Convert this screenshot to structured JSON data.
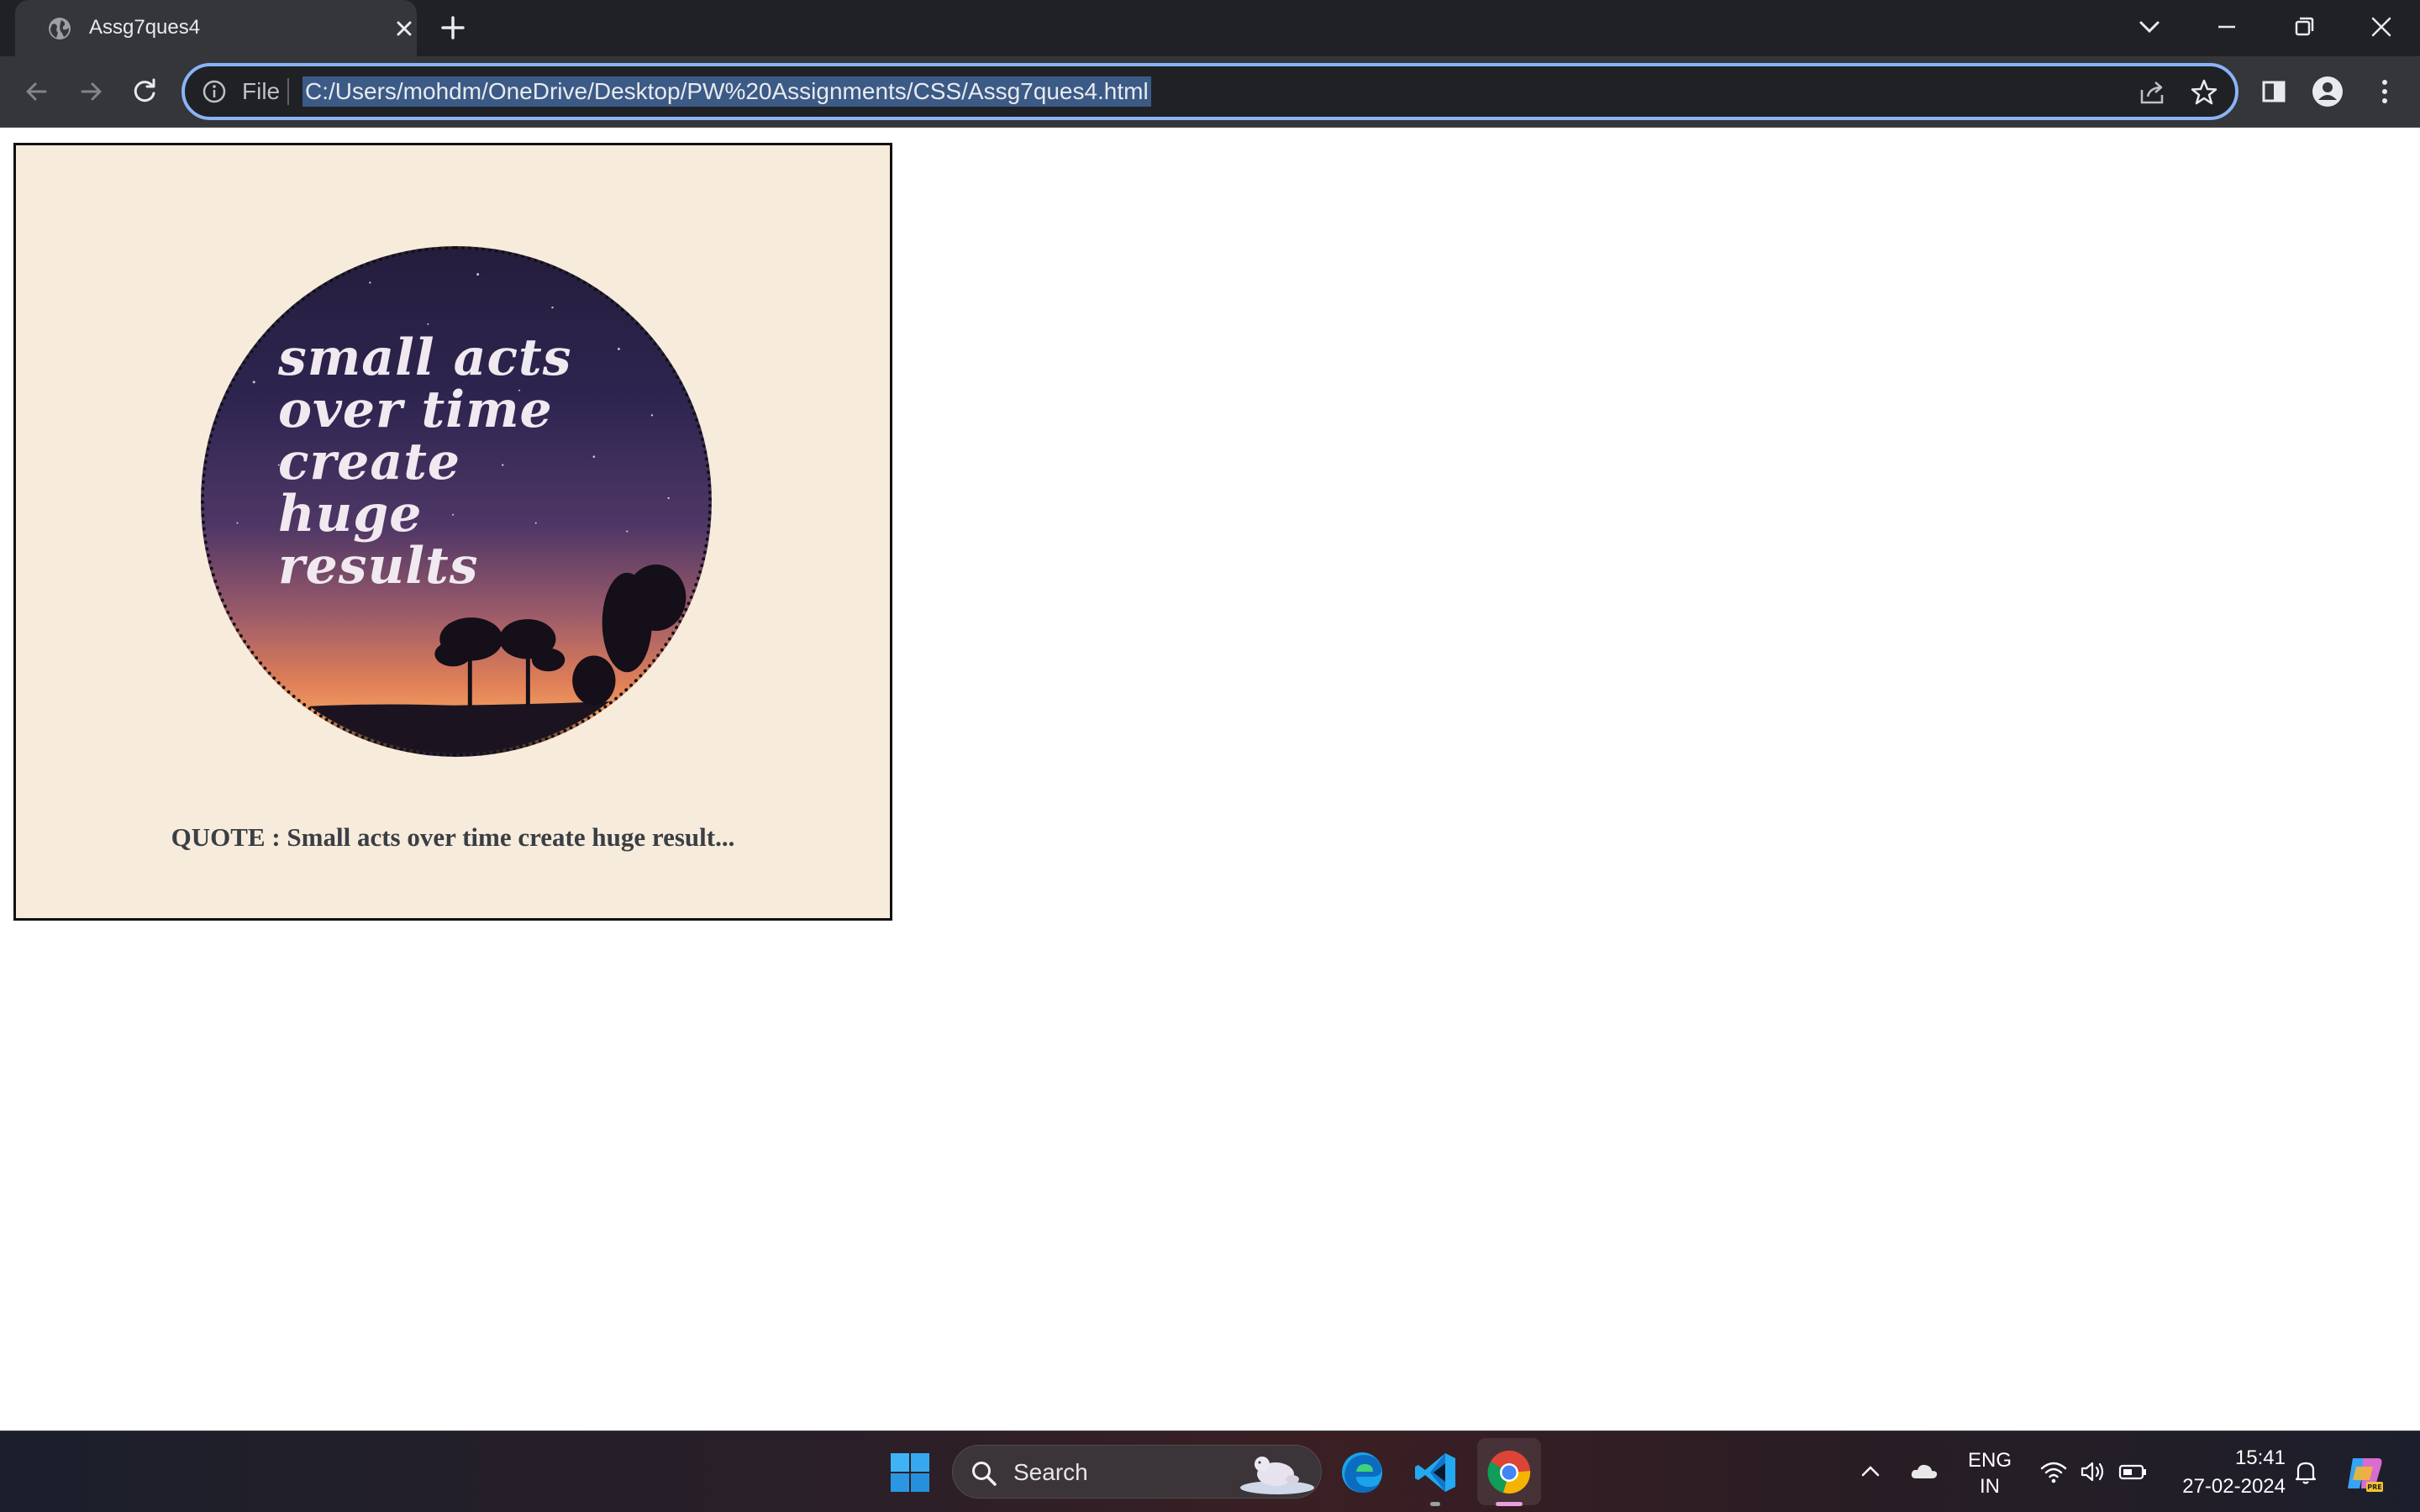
{
  "browser": {
    "tab": {
      "title": "Assg7ques4"
    },
    "omnibox": {
      "scheme_label": "File",
      "url": "C:/Users/mohdm/OneDrive/Desktop/PW%20Assignments/CSS/Assg7ques4.html"
    }
  },
  "page": {
    "quote_image_lines": [
      "small acts",
      "over time",
      "create",
      "huge",
      "results"
    ],
    "caption": "QUOTE : Small acts over time create huge result..."
  },
  "taskbar": {
    "search_placeholder": "Search",
    "language": "ENG",
    "region": "IN",
    "time": "15:41",
    "date": "27-02-2024"
  },
  "colors": {
    "card_bg": "#f7ebdc",
    "omnibox_focus": "#8ab4f8",
    "tab_bar": "#202124",
    "toolbar": "#35363a"
  }
}
